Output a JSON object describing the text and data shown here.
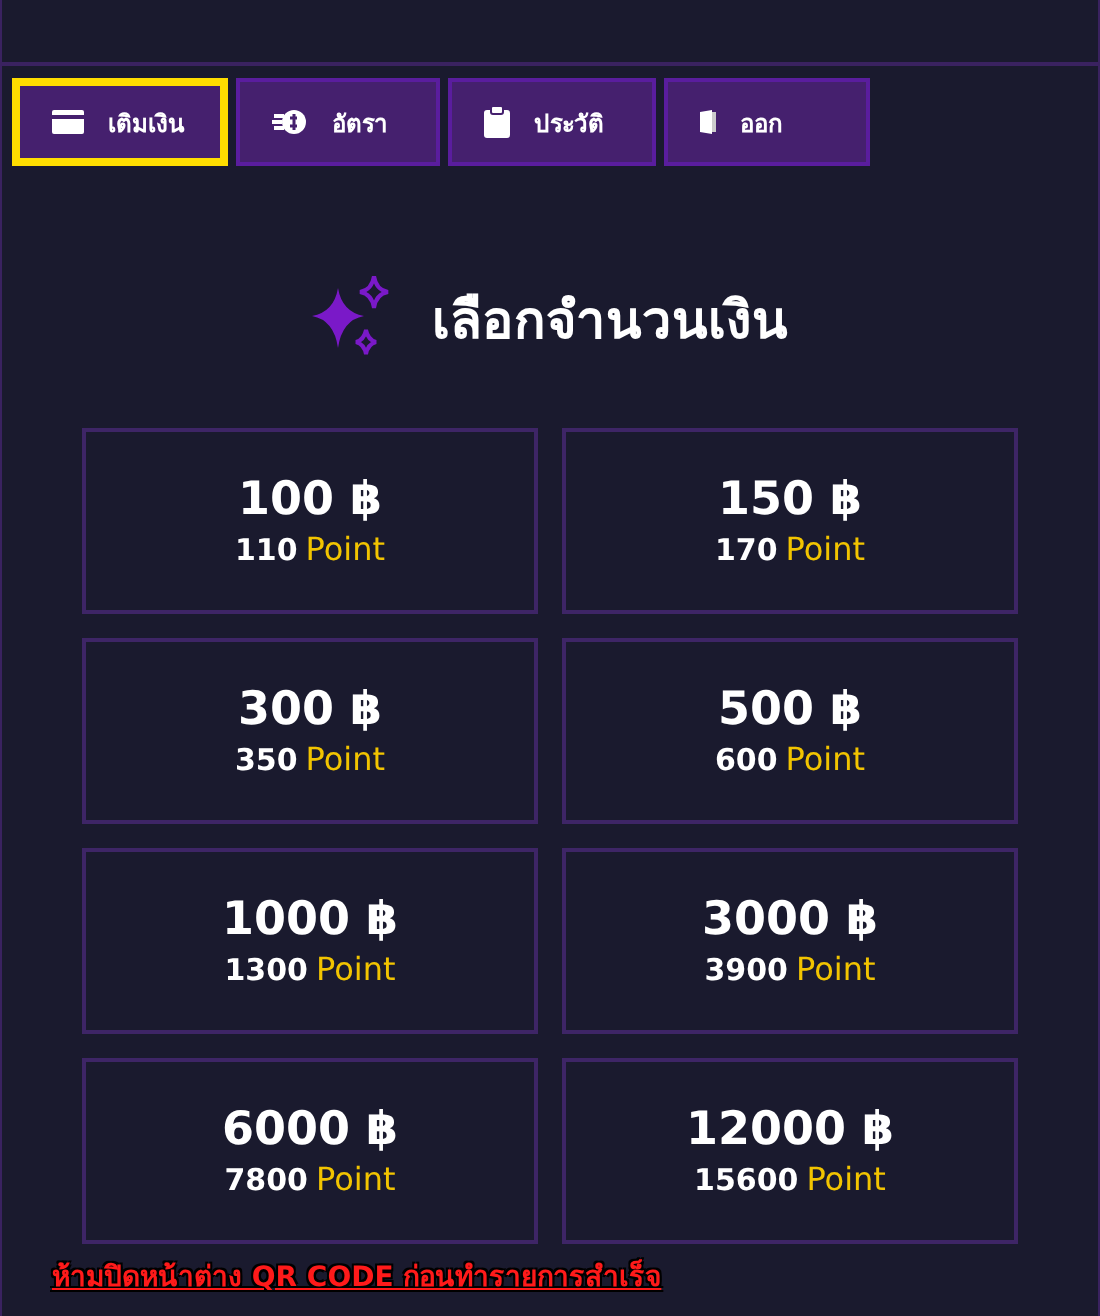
{
  "tabs": [
    {
      "label": "เติมเงิน",
      "kind": "card",
      "selected": true
    },
    {
      "label": "อัตรา",
      "kind": "money",
      "selected": false
    },
    {
      "label": "ประวัติ",
      "kind": "clipboard",
      "selected": false
    },
    {
      "label": "ออก",
      "kind": "door",
      "selected": false
    }
  ],
  "heading": "เลือกจำนวนเงิน",
  "packages": [
    {
      "amount": "100 ฿",
      "points": "110",
      "unit": "Point"
    },
    {
      "amount": "150 ฿",
      "points": "170",
      "unit": "Point"
    },
    {
      "amount": "300 ฿",
      "points": "350",
      "unit": "Point"
    },
    {
      "amount": "500 ฿",
      "points": "600",
      "unit": "Point"
    },
    {
      "amount": "1000 ฿",
      "points": "1300",
      "unit": "Point"
    },
    {
      "amount": "3000 ฿",
      "points": "3900",
      "unit": "Point"
    },
    {
      "amount": "6000 ฿",
      "points": "7800",
      "unit": "Point"
    },
    {
      "amount": "12000 ฿",
      "points": "15600",
      "unit": "Point"
    }
  ],
  "warning": "ห้ามปิดหน้าต่าง QR CODE ก่อนทำรายการสำเร็จ"
}
